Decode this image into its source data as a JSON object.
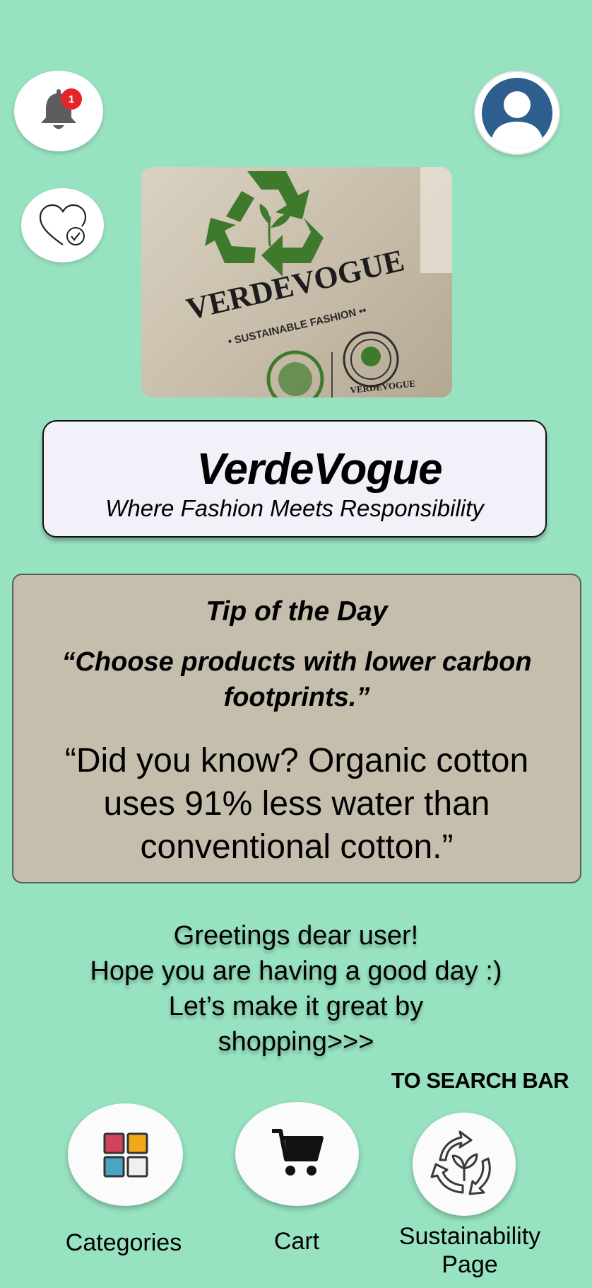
{
  "header": {
    "notification_count": "1",
    "icons": [
      "bell-icon",
      "profile-avatar-icon",
      "heart-check-icon"
    ]
  },
  "banner": {
    "brand": "VERDEVOGUE",
    "subtitle": "• SUSTAINABLE FASHION ••",
    "seal_text": "VERDEVOGUE"
  },
  "title_card": {
    "title": "VerdeVogue",
    "tagline": "Where Fashion Meets Responsibility"
  },
  "tip": {
    "heading": "Tip of the Day",
    "quote": "“Choose products with lower carbon footprints.”",
    "fact": "“Did you know? Organic cotton uses 91% less water than conventional cotton.”"
  },
  "greeting": {
    "line1": "Greetings dear user!",
    "line2": "Hope you are having a good day :)",
    "line3": "Let’s make it great by",
    "line4": "shopping>>>"
  },
  "search_link": "TO SEARCH BAR",
  "nav": {
    "categories": "Categories",
    "cart": "Cart",
    "sustainability_line1": "Sustainability",
    "sustainability_line2": "Page"
  },
  "colors": {
    "background": "#97e2c1",
    "tip_card": "#c5bead",
    "title_card": "#f2f0f8",
    "badge": "#e8242b",
    "brand_green": "#3f7a2c"
  }
}
